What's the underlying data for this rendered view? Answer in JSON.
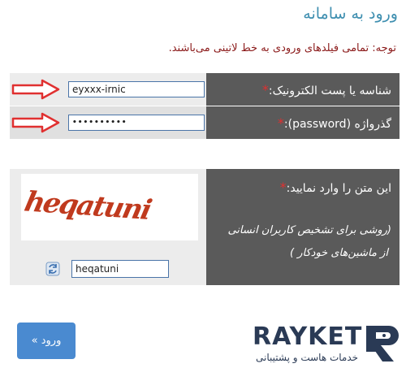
{
  "page": {
    "title": "ورود به سامانه",
    "notice": "توجه: تمامی فیلدهای ورودی به خط لاتینی می‌باشند."
  },
  "login": {
    "email_label": "شناسه یا پست الکترونیک:",
    "email_value": "eyxxx-irnic",
    "password_label": "گذرواژه (password):",
    "password_value": "••••••••••",
    "required_mark": "*"
  },
  "captcha": {
    "label": "این متن را وارد نمایید:",
    "hint_line1": "(روشی برای تشخیص کاربران انسانی",
    "hint_line2": "از ماشین‌های خودکار )",
    "image_text": "heqatuni",
    "input_value": "heqatuni",
    "required_mark": "*"
  },
  "actions": {
    "submit_label": "ورود »"
  },
  "brand": {
    "name": "RAYKET",
    "tagline": "خدمات هاست و پشتیبانی"
  },
  "colors": {
    "title": "#3f8fb0",
    "notice": "#8b1a1a",
    "label_bg": "#5a5a5a",
    "button": "#4a8ad0",
    "arrow": "#e03030",
    "brand": "#2a3a55"
  },
  "icons": {
    "email_arrow": "arrow-right-icon",
    "password_arrow": "arrow-right-icon",
    "refresh": "refresh-icon"
  }
}
